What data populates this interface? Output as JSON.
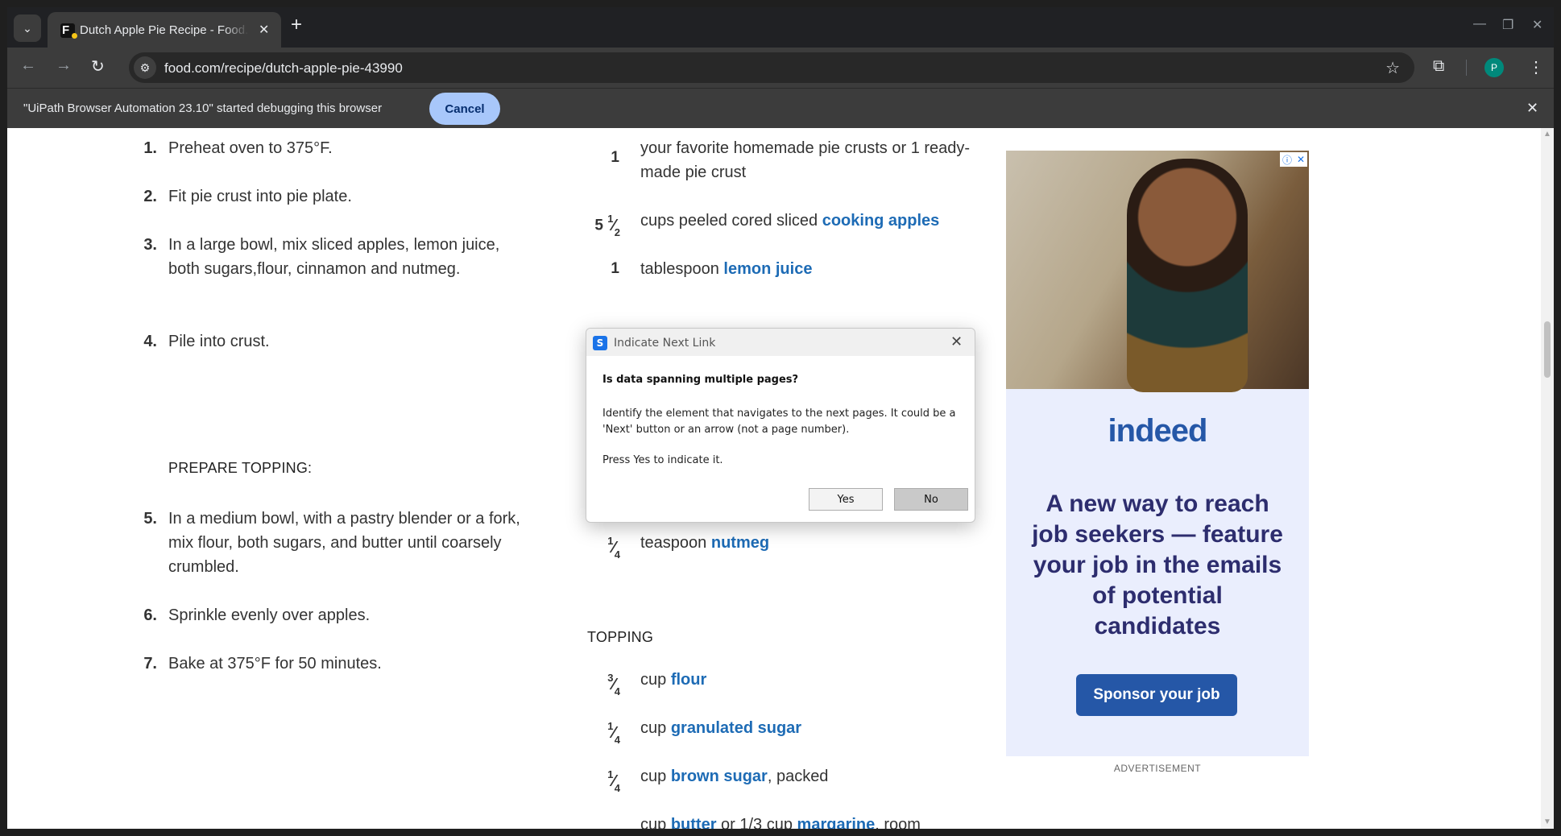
{
  "browser": {
    "tab_title": "Dutch Apple Pie Recipe - Food.com",
    "url": "food.com/recipe/dutch-apple-pie-43990",
    "avatar_letter": "P",
    "infobar_message": "\"UiPath Browser Automation 23.10\" started debugging this browser",
    "infobar_cancel": "Cancel"
  },
  "directions": [
    {
      "num": "1.",
      "text": "Preheat oven to 375°F."
    },
    {
      "num": "2.",
      "text": "Fit pie crust into pie plate."
    },
    {
      "num": "3.",
      "text": "In a large bowl, mix sliced apples, lemon juice, both sugars,flour, cinnamon and nutmeg."
    },
    {
      "num": "4.",
      "text": "Pile into crust."
    },
    {
      "num": "5.",
      "text": "In a medium bowl, with a pastry blender or a fork, mix flour, both sugars, and butter until coarsely crumbled."
    },
    {
      "num": "6.",
      "text": "Sprinkle evenly over apples."
    },
    {
      "num": "7.",
      "text": "Bake at 375°F for 50 minutes."
    }
  ],
  "prepare_topping_heading": "PREPARE TOPPING:",
  "topping_heading": "TOPPING",
  "ingredients_top": [
    {
      "qty_whole": "1",
      "qty_num": "",
      "qty_den": "",
      "pre": "your favorite homemade pie crusts or 1 ready-made pie crust",
      "link": "",
      "post": ""
    },
    {
      "qty_whole": "5",
      "qty_num": "1",
      "qty_den": "2",
      "pre": "cups peeled cored sliced ",
      "link": "cooking apples",
      "post": ""
    },
    {
      "qty_whole": "1",
      "qty_num": "",
      "qty_den": "",
      "pre": "tablespoon ",
      "link": "lemon juice",
      "post": ""
    },
    {
      "qty_whole": "",
      "qty_num": "1",
      "qty_den": "4",
      "pre": "teaspoon ",
      "link": "nutmeg",
      "post": ""
    }
  ],
  "ingredients_topping": [
    {
      "qty_whole": "",
      "qty_num": "3",
      "qty_den": "4",
      "pre": "cup ",
      "link": "flour",
      "post": ""
    },
    {
      "qty_whole": "",
      "qty_num": "1",
      "qty_den": "4",
      "pre": "cup ",
      "link": "granulated sugar",
      "post": ""
    },
    {
      "qty_whole": "",
      "qty_num": "1",
      "qty_den": "4",
      "pre": "cup ",
      "link": "brown sugar",
      "post": ", packed"
    },
    {
      "qty_whole": "",
      "qty_num": "",
      "qty_den": "",
      "pre": "cup ",
      "link": "butter",
      "post": " or 1/3 cup ",
      "link2": "margarine",
      "post2": ", room"
    }
  ],
  "ad": {
    "logo": "indeed",
    "headline": "A new way to reach job seekers — feature your job in the emails of potential candidates",
    "cta": "Sponsor your job",
    "label": "ADVERTISEMENT"
  },
  "dialog": {
    "title": "Indicate Next Link",
    "question": "Is data spanning multiple pages?",
    "body": "Identify the element that navigates to the next pages. It could be a 'Next' button or an arrow (not a page number).",
    "prompt": "Press Yes to indicate it.",
    "yes": "Yes",
    "no": "No"
  },
  "colors": {
    "link": "#1d6bb5",
    "cancel_button": "#a8c7fa",
    "indeed_blue": "#2557a7"
  }
}
